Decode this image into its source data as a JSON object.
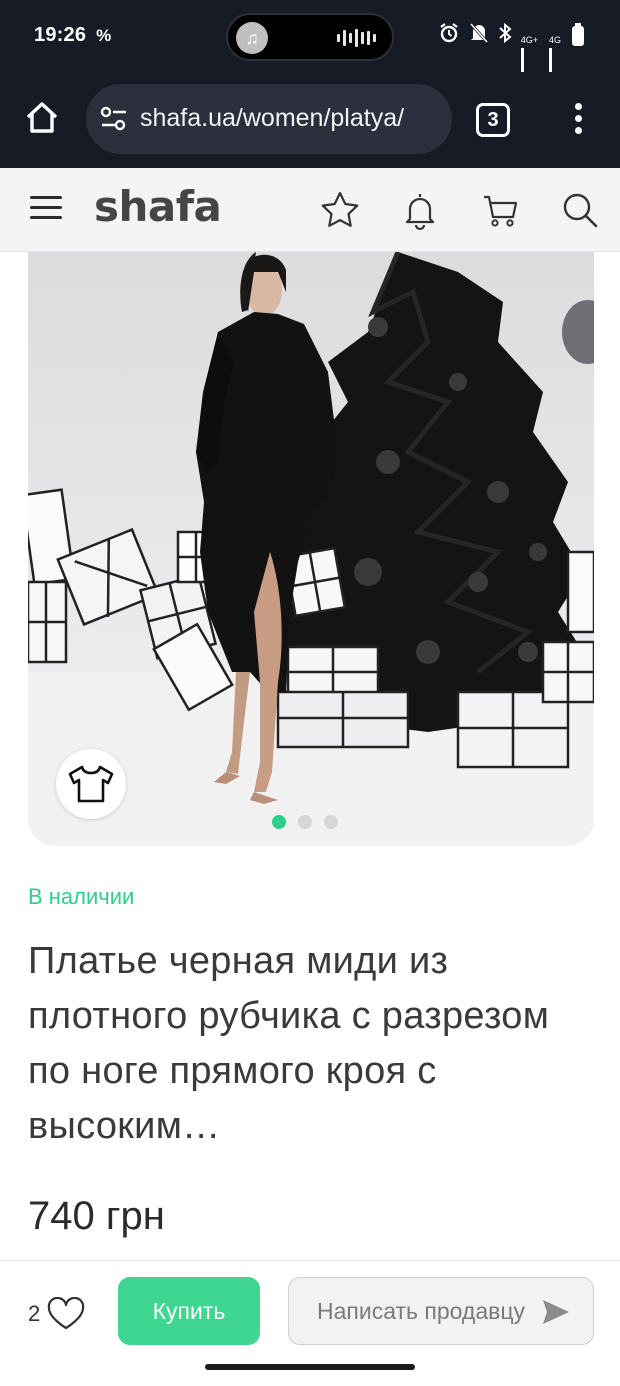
{
  "status_bar": {
    "time": "19:26",
    "battery_saver": "%",
    "network_1": "4G+",
    "network_2": "4G"
  },
  "browser": {
    "url": "shafa.ua/women/platya/",
    "tab_count": "3"
  },
  "header": {
    "logo": "shafa"
  },
  "product": {
    "availability": "В наличии",
    "title": "Платье черная миди из плотного рубчика с разрезом по ноге прямого кроя с высоким…",
    "price": "740 грн",
    "gallery": {
      "count": 3,
      "active_index": 0
    }
  },
  "actions": {
    "likes_count": "2",
    "buy_label": "Купить",
    "message_label": "Написать продавцу"
  },
  "colors": {
    "accent": "#3ed690",
    "availability": "#2ecf8a",
    "browser_chrome": "#171b26",
    "header_bg": "#f4f4f4"
  },
  "icons": [
    "home-icon",
    "site-settings-icon",
    "tabs-icon",
    "more-icon",
    "menu-icon",
    "star-icon",
    "bell-icon",
    "cart-icon",
    "search-icon",
    "tshirt-icon",
    "heart-icon",
    "send-icon"
  ]
}
